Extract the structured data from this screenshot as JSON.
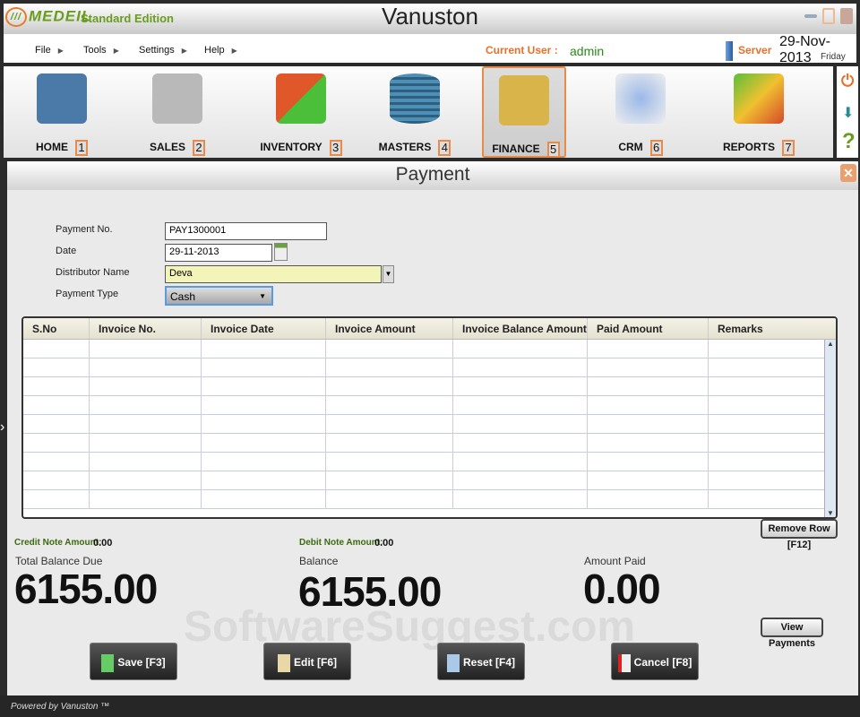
{
  "app": {
    "brand": "MEDEIL",
    "brand_tm": "™",
    "edition": "Standard Edition",
    "title": "Vanuston"
  },
  "menu": [
    "File",
    "Tools",
    "Settings",
    "Help"
  ],
  "user": {
    "label": "Current User :",
    "name": "admin",
    "server": "Server",
    "date": "29-Nov-2013",
    "day": "Friday"
  },
  "toolbar": [
    {
      "label": "HOME",
      "key": "1",
      "color": "#4b7aa8"
    },
    {
      "label": "SALES",
      "key": "2",
      "color": "#b9b9b9"
    },
    {
      "label": "INVENTORY",
      "key": "3",
      "color": "#e0572a"
    },
    {
      "label": "MASTERS",
      "key": "4",
      "color": "#4f8fb6"
    },
    {
      "label": "FINANCE",
      "key": "5",
      "color": "#d9b44a"
    },
    {
      "label": "CRM",
      "key": "6",
      "color": "#5b8ed0"
    },
    {
      "label": "REPORTS",
      "key": "7",
      "color": "#d44a2a"
    }
  ],
  "form": {
    "title": "Payment",
    "payment_no_label": "Payment No.",
    "payment_no": "PAY1300001",
    "date_label": "Date",
    "date": "29-11-2013",
    "distributor_label": "Distributor Name",
    "distributor": "Deva",
    "payment_type_label": "Payment Type",
    "payment_type": "Cash"
  },
  "table": {
    "columns": [
      "S.No",
      "Invoice No.",
      "Invoice Date",
      "Invoice Amount",
      "Invoice Balance Amount",
      "Paid Amount",
      "Remarks"
    ]
  },
  "summary": {
    "credit_label": "Credit Note Amount:",
    "credit": "0.00",
    "debit_label": "Debit Note Amount:",
    "debit": "0.00",
    "total_due_label": "Total Balance Due",
    "total_due": "6155.00",
    "balance_label": "Balance",
    "balance": "6155.00",
    "paid_label": "Amount Paid",
    "paid": "0.00"
  },
  "buttons": {
    "remove_row": "Remove Row  [F12]",
    "view_payments": "View Payments",
    "save": "Save [F3]",
    "edit": "Edit [F6]",
    "reset": "Reset [F4]",
    "cancel": "Cancel [F8]"
  },
  "watermark": "SoftwareSuggest.com",
  "footer": {
    "powered": "Powered by Vanuston ™"
  }
}
